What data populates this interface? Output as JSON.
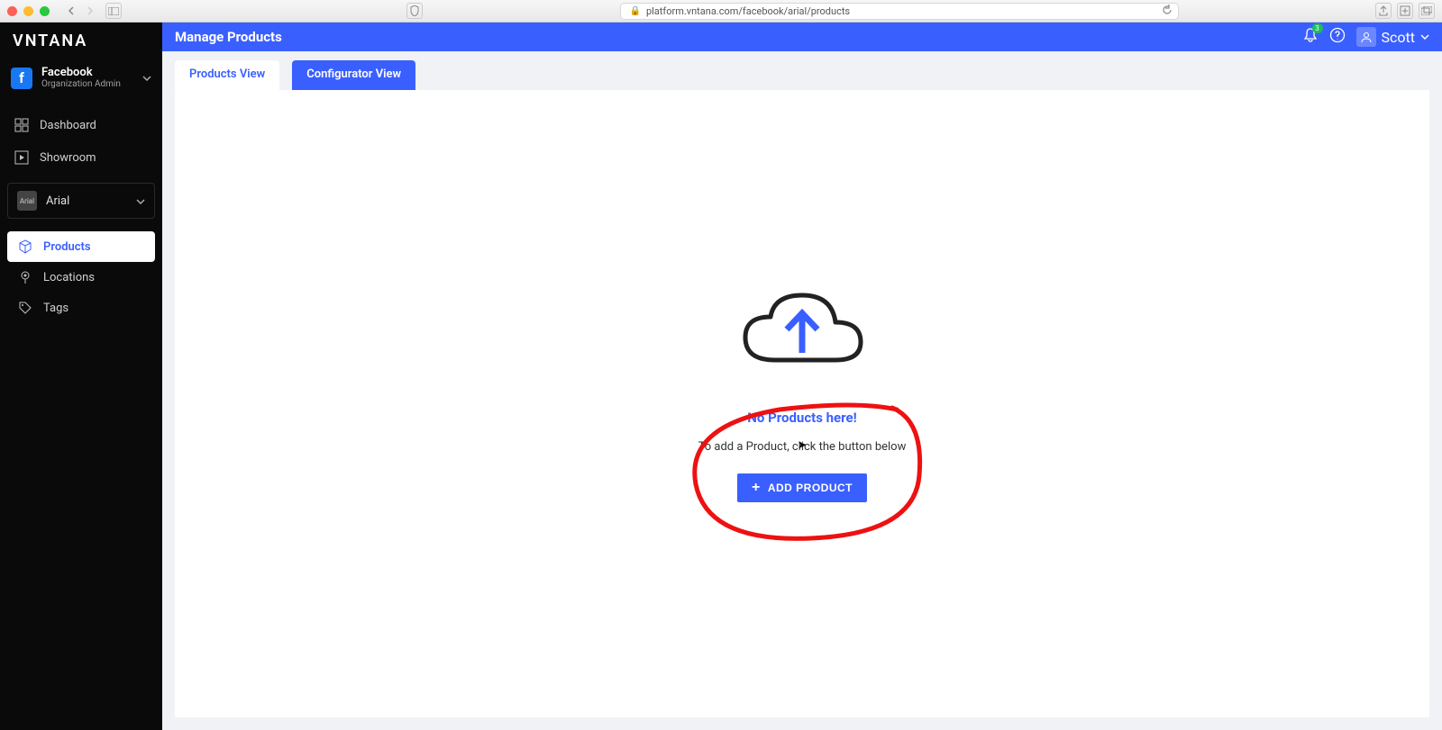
{
  "browser": {
    "url": "platform.vntana.com/facebook/arial/products"
  },
  "brand": "VNTANA",
  "org": {
    "name": "Facebook",
    "role": "Organization Admin"
  },
  "sidebar": {
    "dashboard": "Dashboard",
    "showroom": "Showroom"
  },
  "project": {
    "name": "Arial",
    "thumb": "Arial"
  },
  "subnav": {
    "products": "Products",
    "locations": "Locations",
    "tags": "Tags"
  },
  "header": {
    "title": "Manage Products",
    "user": "Scott",
    "notif_count": "3"
  },
  "tabs": {
    "products_view": "Products View",
    "configurator_view": "Configurator View"
  },
  "empty": {
    "title": "No Products here!",
    "subtitle": "To add a Product, click the button below",
    "add_label": "ADD PRODUCT"
  }
}
